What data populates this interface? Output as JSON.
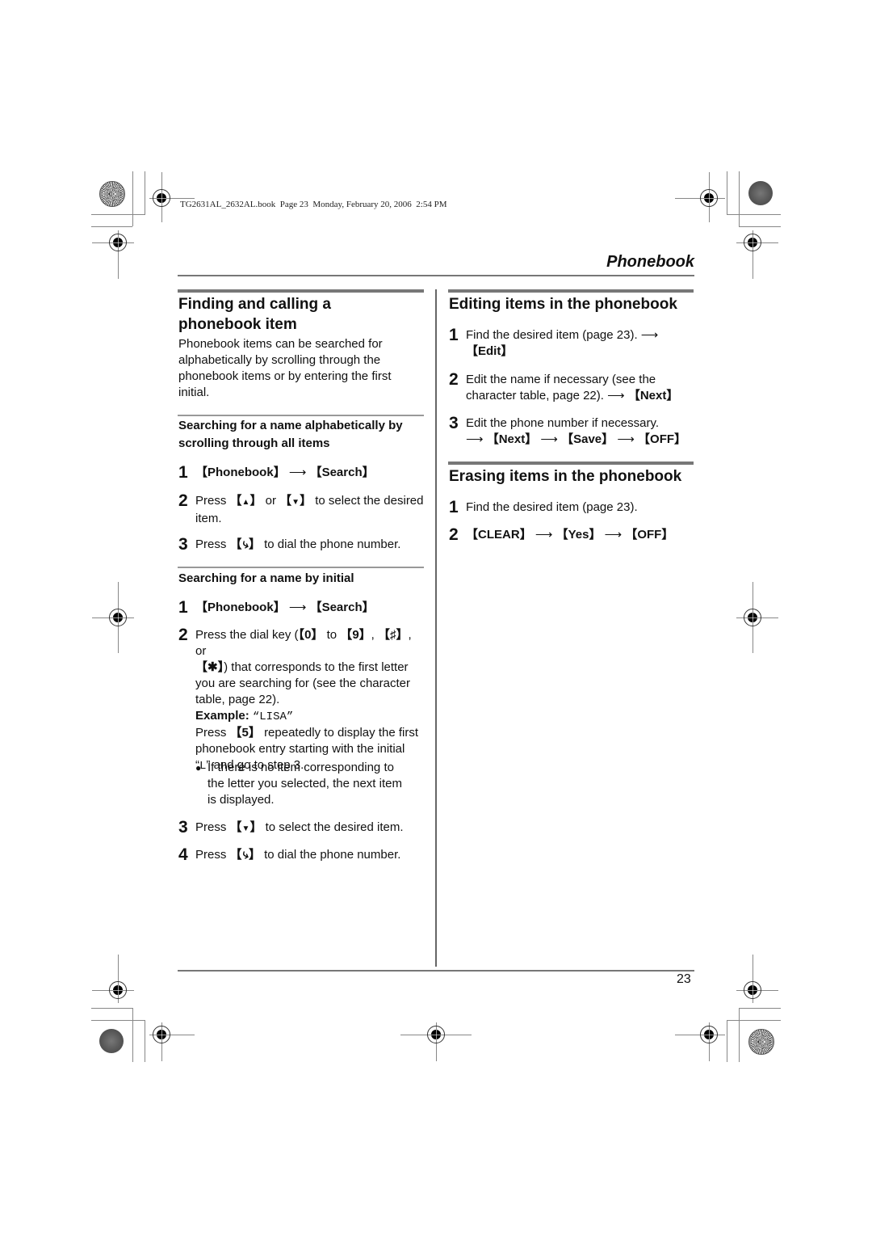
{
  "print_header": "TG2631AL_2632AL.book  Page 23  Monday, February 20, 2006  2:54 PM",
  "section_title": "Phonebook",
  "page_number": "23",
  "left": {
    "title_line1": "Finding and calling a",
    "title_line2": "phonebook item",
    "intro": [
      "Phonebook items can be searched for",
      "alphabetically by scrolling through the",
      "phonebook items or by entering the first",
      "initial."
    ],
    "sub1_line1": "Searching for a name alphabetically by",
    "sub1_line2": "scrolling through all items",
    "sub1_steps": [
      {
        "num": "1",
        "lines": [
          "【Phonebook】 → 【Search】"
        ]
      },
      {
        "num": "2",
        "lines": [
          "Press 【▲】 or 【▼】 to select the desired",
          "item."
        ]
      },
      {
        "num": "3",
        "lines": [
          "Press 【talk】 to dial the phone number."
        ]
      }
    ],
    "sub2_title": "Searching for a name by initial",
    "sub2_steps": [
      {
        "num": "1",
        "lines": [
          "【Phonebook】 → 【Search】"
        ]
      },
      {
        "num": "2",
        "lines": [
          "Press the dial key (【0】 to 【9】, 【#】, or",
          "【*】) that corresponds to the first letter",
          "you are searching for (see the character",
          "table, page 22)."
        ]
      },
      {
        "num": "3",
        "lines": [
          "Press 【▼】 to select the desired item."
        ]
      },
      {
        "num": "4",
        "lines": [
          "Press 【talk】 to dial the phone number."
        ]
      }
    ],
    "example_label": "Example:",
    "example_value": "“LISA”",
    "example_lines": [
      "Press 【5】 repeatedly to display the first",
      "phonebook entry starting with the initial",
      "“L” and go to step 3."
    ],
    "bullet_lines": [
      "If there is no item corresponding to",
      "the letter you selected, the next item",
      "is displayed."
    ]
  },
  "right": {
    "edit_title": "Editing items in the phonebook",
    "edit_steps": [
      {
        "num": "1",
        "lines": [
          "Find the desired item (page 23). →",
          "【Edit】"
        ]
      },
      {
        "num": "2",
        "lines": [
          "Edit the name if necessary (see the",
          "character table, page 22). → 【Next】"
        ]
      },
      {
        "num": "3",
        "lines": [
          "Edit the phone number if necessary.",
          "→ 【Next】 → 【Save】 → 【OFF】"
        ]
      }
    ],
    "erase_title": "Erasing items in the phonebook",
    "erase_steps": [
      {
        "num": "1",
        "lines": [
          "Find the desired item (page 23)."
        ]
      },
      {
        "num": "2",
        "lines": [
          "【CLEAR】 → 【Yes】 → 【OFF】"
        ]
      }
    ]
  },
  "keys": {
    "phonebook": "Phonebook",
    "search": "Search",
    "up": "▲",
    "down": "▼",
    "talk": "☎",
    "zero": "0",
    "nine": "9",
    "hash": "♯",
    "star": "✱",
    "five": "5",
    "edit": "Edit",
    "next": "Next",
    "save": "Save",
    "off": "OFF",
    "clear": "CLEAR",
    "yes": "Yes",
    "arrow": "⟶"
  },
  "text": {
    "press": "Press",
    "or": "or",
    "to": "to",
    "select_desired": "to select the desired",
    "item_dot": "item.",
    "dial_number": "to dial the phone number.",
    "press_dial_key": "Press the dial key (",
    "comma": ",",
    "or_comma": ", or",
    "corresponds": ") that corresponds to the first letter",
    "searching_for": "you are searching for (see the character",
    "table_page": "table, page 22).",
    "repeatedly": "repeatedly to display the first",
    "entry_starting": "phonebook entry starting with the initial",
    "quote_open": "“",
    "letter_l": "L",
    "go_step": "” and go to step 3.",
    "select_desired_item": "to select the desired item.",
    "find_item": "Find the desired item (page 23).",
    "edit_name": "Edit the name if necessary (see the",
    "char_table": "character table, page 22).",
    "edit_number": "Edit the phone number if necessary."
  }
}
